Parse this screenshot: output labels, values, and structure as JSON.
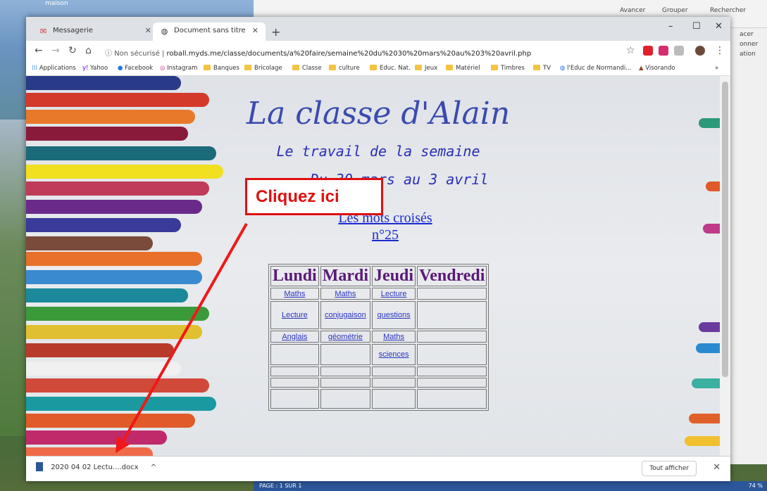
{
  "desktop": {
    "maison_label": "maison"
  },
  "word": {
    "ribbon": {
      "avancer": "Avancer",
      "grouper": "Grouper",
      "rechercher": "Rechercher"
    },
    "right_panel": [
      "acer",
      "onner",
      "ation"
    ],
    "status": {
      "page": "PAGE : 1 SUR 1",
      "zoom": "74 %"
    }
  },
  "browser": {
    "tabs": [
      {
        "label": "Messagerie",
        "icon": "gmail-icon"
      },
      {
        "label": "Document sans titre",
        "icon": "globe-icon"
      }
    ],
    "new_tab": "+",
    "window_controls": {
      "minimize": "–",
      "maximize": "☐",
      "close": "✕"
    },
    "security": "Non sécurisé",
    "url": "roball.myds.me/classe/documents/a%20faire/semaine%20du%2030%20mars%20au%203%20avril.php",
    "bookmarks": [
      "Applications",
      "Yahoo",
      "Facebook",
      "Instagram",
      "Banques",
      "Bricolage",
      "Classe",
      "culture",
      "Educ. Nat.",
      "Jeux",
      "Matériel",
      "Timbres",
      "TV",
      "l'Educ de Normandi...",
      "Visorando"
    ],
    "bookmarks_more": "»"
  },
  "page": {
    "title": "La classe d'Alain",
    "subtitle": "Le travail de la semaine",
    "dates": "Du 30 mars au 3 avril",
    "mots_croises": "Les mots croisés",
    "mots_number": "n°25",
    "callout": "Cliquez ici",
    "table": {
      "headers": [
        "Lundi",
        "Mardi",
        "Jeudi",
        "Vendredi"
      ],
      "rows": [
        [
          "Maths",
          "Maths",
          "Lecture",
          ""
        ],
        [
          "Lecture",
          "conjugaison",
          "questions",
          ""
        ],
        [
          "Anglais",
          "géométrie",
          "Maths",
          ""
        ],
        [
          "",
          "",
          "sciences",
          ""
        ],
        [
          "",
          "",
          "",
          ""
        ],
        [
          "",
          "",
          "",
          ""
        ],
        [
          "",
          "",
          "",
          ""
        ]
      ]
    }
  },
  "download": {
    "file": "2020 04 02 Lectu....docx",
    "chevron": "^",
    "show_all": "Tout afficher",
    "close": "✕"
  }
}
